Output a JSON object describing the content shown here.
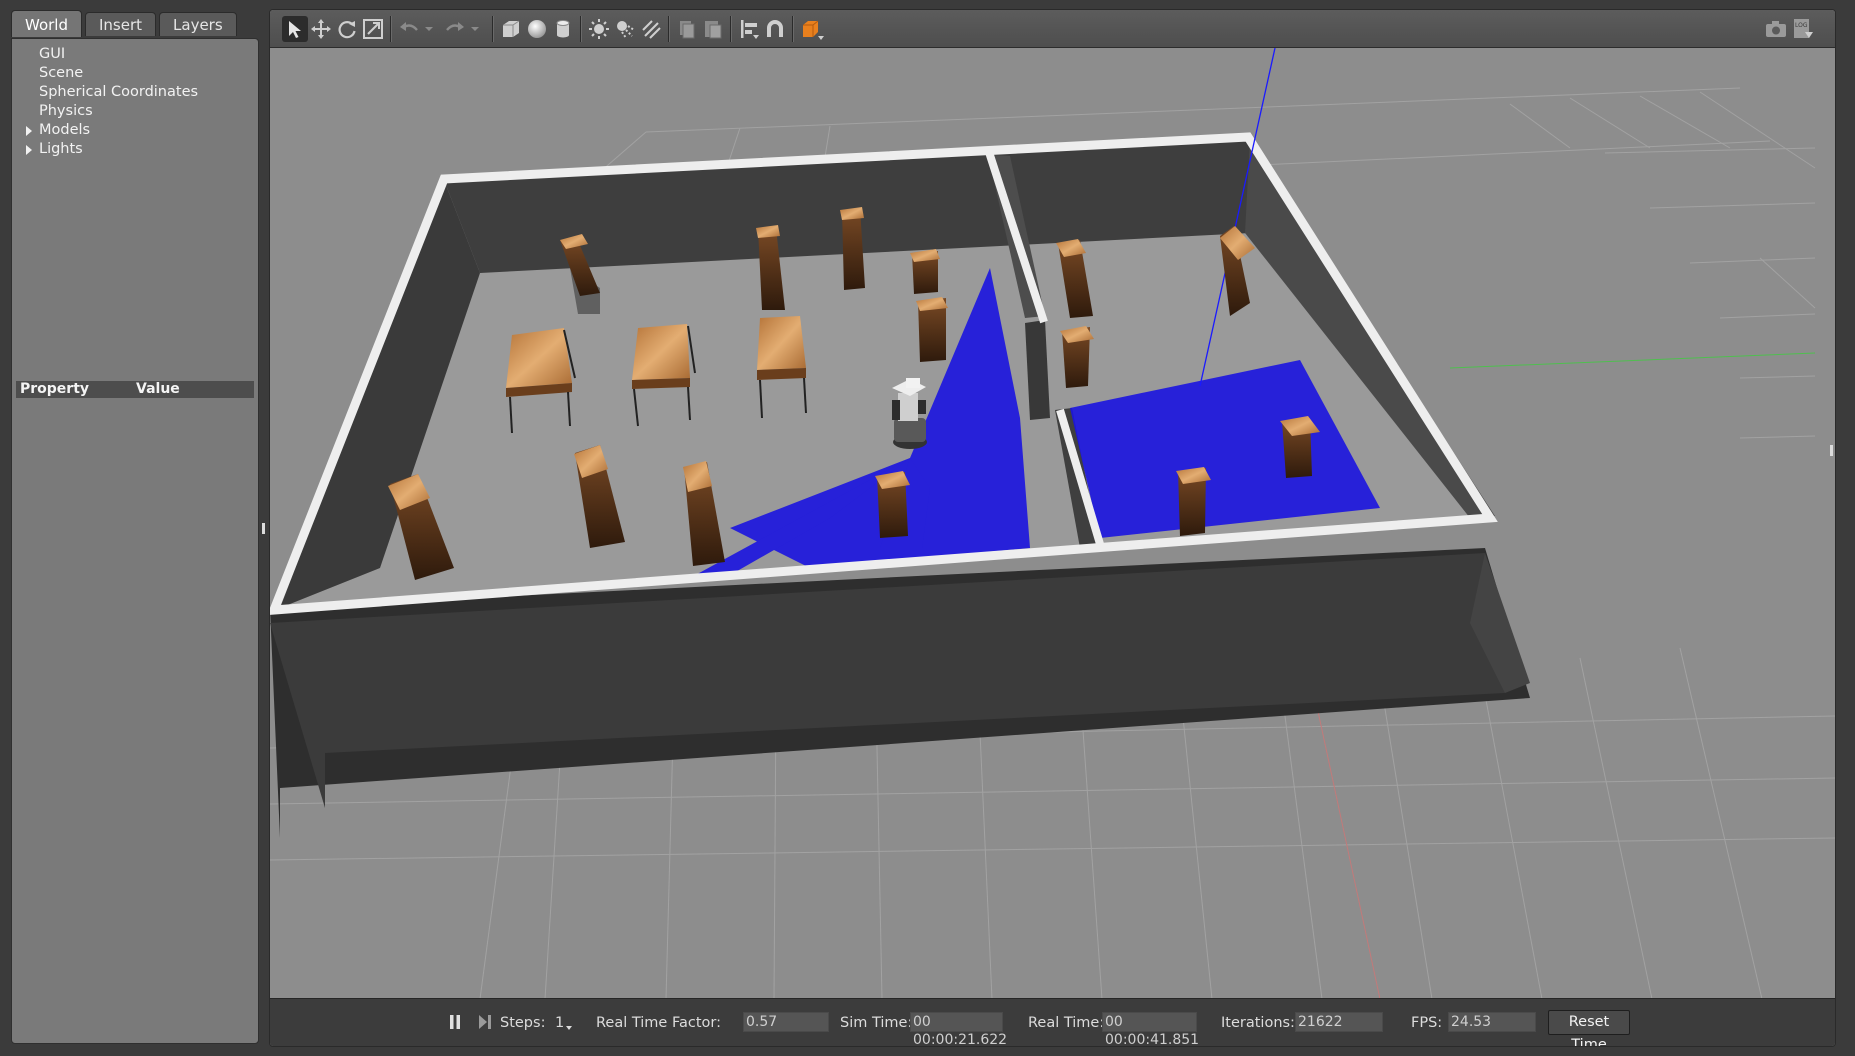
{
  "tabs": [
    "World",
    "Insert",
    "Layers"
  ],
  "world_tree": [
    {
      "label": "GUI",
      "expandable": false
    },
    {
      "label": "Scene",
      "expandable": false
    },
    {
      "label": "Spherical Coordinates",
      "expandable": false
    },
    {
      "label": "Physics",
      "expandable": false
    },
    {
      "label": "Models",
      "expandable": true
    },
    {
      "label": "Lights",
      "expandable": true
    }
  ],
  "properties": {
    "col_property": "Property",
    "col_value": "Value"
  },
  "toolbar": {
    "tools": [
      "select-mode-icon",
      "translate-mode-icon",
      "rotate-mode-icon",
      "scale-mode-icon",
      "undo-icon",
      "undo-history-icon",
      "redo-icon",
      "redo-history-icon",
      "box-shape-icon",
      "sphere-shape-icon",
      "cylinder-shape-icon",
      "point-light-icon",
      "spot-light-icon",
      "directional-light-icon",
      "copy-icon",
      "paste-icon",
      "align-icon",
      "snap-icon",
      "view-angle-icon",
      "screenshot-icon",
      "log-icon"
    ],
    "active_tool": "select-mode-icon"
  },
  "bottom_bar": {
    "steps_label": "Steps:",
    "steps_value": "1",
    "rtf_label": "Real Time Factor:",
    "rtf_value": "0.57",
    "sim_time_label": "Sim Time:",
    "sim_time_value": "00 00:00:21.622",
    "real_time_label": "Real Time:",
    "real_time_value": "00 00:00:41.851",
    "iterations_label": "Iterations:",
    "iterations_value": "21622",
    "fps_label": "FPS:",
    "fps_value": "24.53",
    "reset_label": "Reset Time"
  },
  "colors": {
    "laser": "#1b14e0",
    "wood": "#c98a4b",
    "wall_top": "#eeeeee",
    "wall_side": "#3a3a3a",
    "floor": "#8c8c8c"
  }
}
